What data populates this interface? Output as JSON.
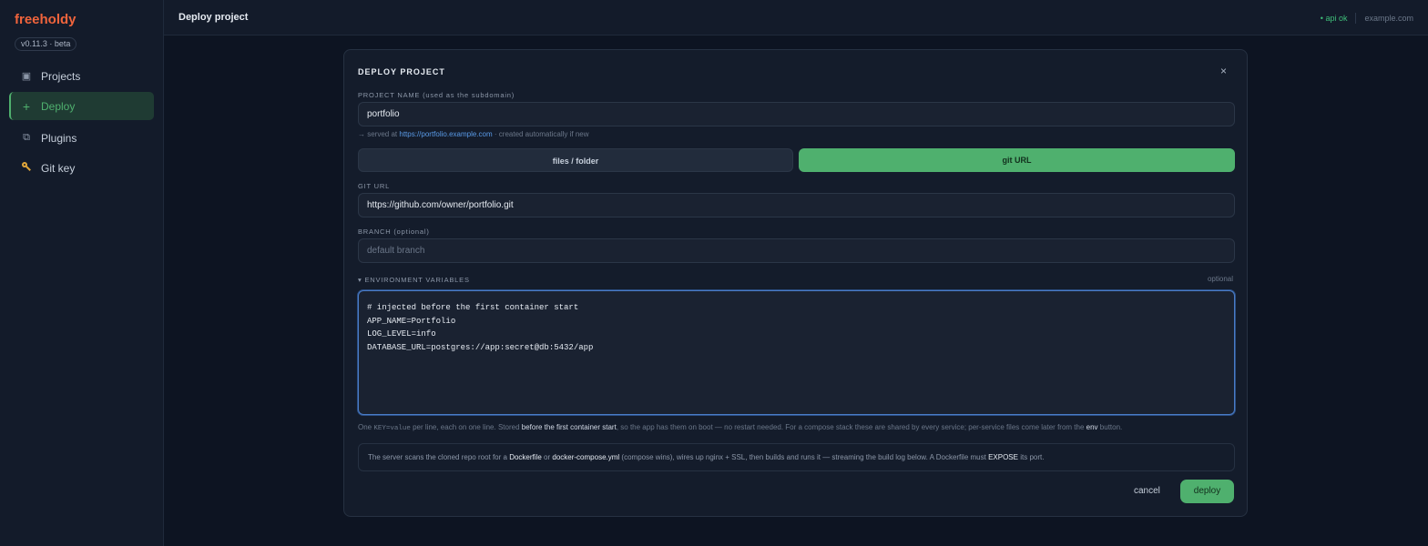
{
  "app": {
    "brand": "freeholdy",
    "version": "v0.11.3 · beta"
  },
  "sidebar": {
    "items": [
      {
        "label": "Projects",
        "icon": "square-icon",
        "active": false
      },
      {
        "label": "Deploy",
        "icon": "plus-icon",
        "active": true
      },
      {
        "label": "Plugins",
        "icon": "plugin-icon",
        "active": false
      },
      {
        "label": "Git key",
        "icon": "key-icon",
        "active": false
      }
    ]
  },
  "topbar": {
    "title": "Deploy project",
    "status": "• api ok",
    "domain": "example.com"
  },
  "modal": {
    "title": "DEPLOY PROJECT",
    "close": "×",
    "project_name_label": "PROJECT NAME (used as the subdomain)",
    "project_name_value": "portfolio",
    "hint_prefix": "→ served at",
    "hint_url": "https://portfolio.example.com",
    "hint_suffix": "· created automatically if new",
    "source_tabs": {
      "files": "files / folder",
      "git": "git URL",
      "selected": "git URL"
    },
    "git_url_label": "GIT URL",
    "git_url_value": "https://github.com/owner/portfolio.git",
    "branch_label": "BRANCH (optional)",
    "branch_placeholder": "default branch",
    "env_label": "▾ ENVIRONMENT VARIABLES",
    "env_optional": "optional",
    "env_value": "# injected before the first container start\nAPP_NAME=Portfolio\nLOG_LEVEL=info\nDATABASE_URL=postgres://app:secret@db:5432/app",
    "env_help": {
      "p1": "One",
      "code": "KEY=value",
      "p2": "per line, each on one line. Stored",
      "b1": "before the first container start",
      "p3": ", so the app has them on boot — no restart needed. For a compose stack these are shared by every service; per-service files come later from the",
      "b2": "env",
      "p4": "button."
    },
    "info": {
      "p1": "The server scans the cloned repo root for a",
      "b1": "Dockerfile",
      "p2": "or",
      "b2": "docker-compose.yml",
      "p3": "(compose wins), wires up nginx + SSL, then builds and runs it — streaming the build log below. A Dockerfile must",
      "b3": "EXPOSE",
      "p4": "its port."
    },
    "cancel_label": "cancel",
    "deploy_label": "deploy"
  },
  "colors": {
    "accent": "#4fb06e",
    "brand": "#f0643c",
    "link": "#5a9be8",
    "background": "#0d1422"
  }
}
